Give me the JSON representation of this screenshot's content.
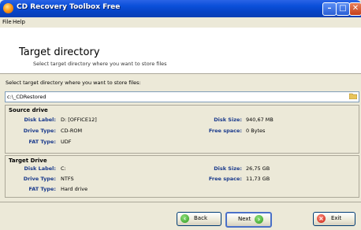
{
  "window": {
    "title": "CD Recovery Toolbox Free"
  },
  "menu": {
    "file": "File",
    "help": "Help"
  },
  "header": {
    "title": "Target directory",
    "subtitle": "Select target directory where you want to store files"
  },
  "target_path": {
    "label": "Select target directory where you want to store files:",
    "value": "c:\\_CDRestored"
  },
  "source_drive": {
    "title": "Source drive",
    "disk_label_label": "Disk Label:",
    "disk_label_value": "D: [OFFICE12]",
    "drive_type_label": "Drive Type:",
    "drive_type_value": "CD-ROM",
    "fat_type_label": "FAT Type:",
    "fat_type_value": "UDF",
    "disk_size_label": "Disk Size:",
    "disk_size_value": "940,67 MB",
    "free_space_label": "Free space:",
    "free_space_value": "0 Bytes"
  },
  "target_drive": {
    "title": "Target Drive",
    "disk_label_label": "Disk Label:",
    "disk_label_value": "C:",
    "drive_type_label": "Drive Type:",
    "drive_type_value": "NTFS",
    "fat_type_label": "FAT Type:",
    "fat_type_value": "Hard drive",
    "disk_size_label": "Disk Size:",
    "disk_size_value": "26,75 GB",
    "free_space_label": "Free space:",
    "free_space_value": "11,73 GB"
  },
  "buttons": {
    "back": "Back",
    "next": "Next",
    "exit": "Exit"
  },
  "icons": {
    "app": "cd-recovery-app-icon",
    "folder": "folder-icon",
    "back": "back-arrow-icon",
    "next": "next-arrow-icon",
    "exit": "exit-icon"
  },
  "colors": {
    "titlebar": "#0a4fd9",
    "label_blue": "#1a3a8c",
    "background": "#ece9d8"
  }
}
